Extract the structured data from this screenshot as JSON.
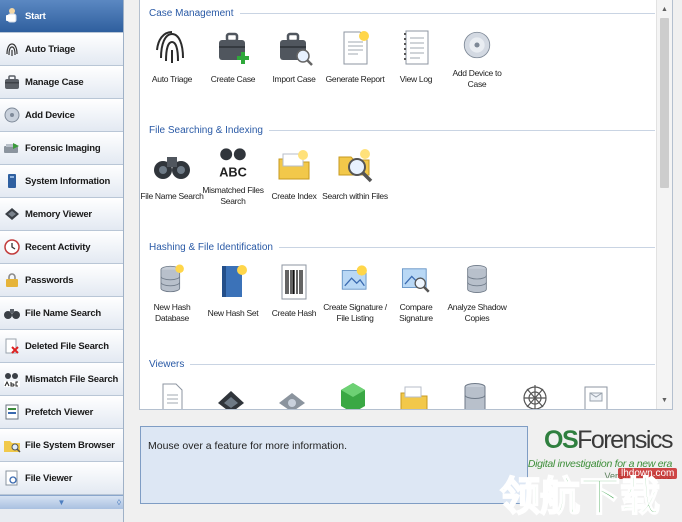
{
  "sidebar": {
    "items": [
      {
        "label": "Start",
        "icon": "start-icon",
        "active": true
      },
      {
        "label": "Auto Triage",
        "icon": "fingerprint-icon"
      },
      {
        "label": "Manage Case",
        "icon": "briefcase-icon"
      },
      {
        "label": "Add Device",
        "icon": "disk-icon"
      },
      {
        "label": "Forensic Imaging",
        "icon": "imaging-icon"
      },
      {
        "label": "System Information",
        "icon": "computer-icon"
      },
      {
        "label": "Memory Viewer",
        "icon": "memory-icon"
      },
      {
        "label": "Recent Activity",
        "icon": "activity-icon"
      },
      {
        "label": "Passwords",
        "icon": "lock-icon"
      },
      {
        "label": "File Name Search",
        "icon": "binoculars-icon"
      },
      {
        "label": "Deleted File Search",
        "icon": "deleted-file-icon"
      },
      {
        "label": "Mismatch File Search",
        "icon": "abc-icon"
      },
      {
        "label": "Prefetch Viewer",
        "icon": "prefetch-icon"
      },
      {
        "label": "File System Browser",
        "icon": "folder-search-icon"
      },
      {
        "label": "File Viewer",
        "icon": "file-viewer-icon"
      }
    ]
  },
  "sections": [
    {
      "title": "Case Management",
      "items": [
        {
          "label": "Auto Triage",
          "icon": "fingerprint-icon"
        },
        {
          "label": "Create Case",
          "icon": "create-case-icon"
        },
        {
          "label": "Import Case",
          "icon": "import-case-icon"
        },
        {
          "label": "Generate Report",
          "icon": "report-icon"
        },
        {
          "label": "View Log",
          "icon": "log-icon"
        },
        {
          "label": "Add Device to Case",
          "icon": "add-device-icon"
        }
      ]
    },
    {
      "title": "File Searching & Indexing",
      "items": [
        {
          "label": "File Name Search",
          "icon": "binoculars-icon"
        },
        {
          "label": "Mismatched Files Search",
          "icon": "abc-binoculars-icon"
        },
        {
          "label": "Create Index",
          "icon": "create-index-icon"
        },
        {
          "label": "Search within Files",
          "icon": "search-files-icon"
        }
      ]
    },
    {
      "title": "Hashing & File Identification",
      "items": [
        {
          "label": "New Hash Database",
          "icon": "hash-database-icon"
        },
        {
          "label": "New Hash Set",
          "icon": "hash-set-icon"
        },
        {
          "label": "Create Hash",
          "icon": "barcode-icon"
        },
        {
          "label": "Create Signature / File Listing",
          "icon": "signature-icon"
        },
        {
          "label": "Compare Signature",
          "icon": "compare-signature-icon"
        },
        {
          "label": "Analyze Shadow Copies",
          "icon": "shadow-copies-icon"
        }
      ]
    },
    {
      "title": "Viewers",
      "items": [
        {
          "icon": "document-viewer-icon"
        },
        {
          "icon": "memory-chip-icon"
        },
        {
          "icon": "drive-viewer-icon"
        },
        {
          "icon": "green-box-icon"
        },
        {
          "icon": "folder-viewer-icon"
        },
        {
          "icon": "database-viewer-icon"
        },
        {
          "icon": "web-icon"
        },
        {
          "icon": "email-icon"
        }
      ]
    }
  ],
  "info": {
    "text": "Mouse over a feature for more information."
  },
  "brand": {
    "name_os": "OS",
    "name_rest": "Forensics",
    "tagline": "Digital investigation for a new era",
    "version": "Version 6.1.1002"
  },
  "watermark": {
    "site": "lhdown.com",
    "text": "领航下载"
  }
}
